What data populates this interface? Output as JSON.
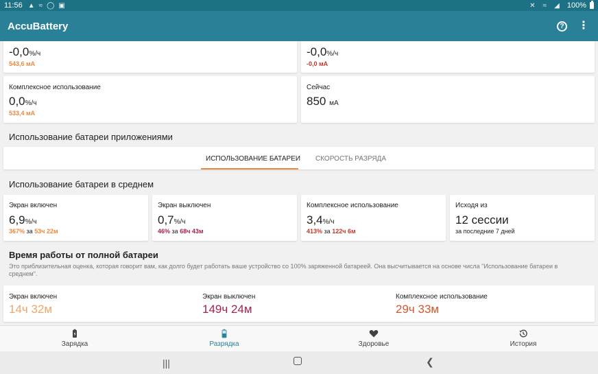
{
  "status_bar": {
    "time": "11:56",
    "battery": "100%",
    "icons": [
      "notification-icon",
      "cast-icon",
      "data-saver-icon",
      "gallery-icon",
      "mute-icon",
      "wifi-icon",
      "signal-icon",
      "battery-icon"
    ]
  },
  "app_bar": {
    "title": "AccuBattery",
    "help_icon": "help-icon",
    "more_icon": "more-vert-icon"
  },
  "top_cards": [
    {
      "label": "",
      "value": "-0,0",
      "unit": "%/ч",
      "sub": "543,6 мА",
      "sub_color": "#e8893f"
    },
    {
      "label": "",
      "value": "-0,0",
      "unit": "%/ч",
      "sub": "-0,0 мА",
      "sub_color": "#c0392b"
    },
    {
      "label": "Комплексное использование",
      "value": "0,0",
      "unit": "%/ч",
      "sub": "533,4 мА",
      "sub_color": "#e8893f"
    },
    {
      "label": "Сейчас",
      "value": "850",
      "unit": "мА",
      "sub": ""
    }
  ],
  "app_usage": {
    "title": "Использование батареи приложениями",
    "tabs": [
      {
        "label": "ИСПОЛЬЗОВАНИЕ БАТАРЕИ",
        "active": true
      },
      {
        "label": "СКОРОСТЬ РАЗРЯДА",
        "active": false
      }
    ]
  },
  "average": {
    "title": "Использование батареи в среднем",
    "cards": [
      {
        "label": "Экран включен",
        "value": "6,9",
        "unit": "%/ч",
        "pct": "367%",
        "over": "за",
        "duration": "53ч 22м",
        "color": "#e8893f"
      },
      {
        "label": "Экран выключен",
        "value": "0,7",
        "unit": "%/ч",
        "pct": "46%",
        "over": "за",
        "duration": "68ч 43м",
        "color": "#a5224f"
      },
      {
        "label": "Комплексное использование",
        "value": "3,4",
        "unit": "%/ч",
        "pct": "413%",
        "over": "за",
        "duration": "122ч 6м",
        "color": "#c0392b"
      },
      {
        "label": "Исходя из",
        "value": "12 сессии",
        "unit": "",
        "sub": "за последние 7 дней"
      }
    ]
  },
  "full_battery": {
    "title": "Время работы от полной батареи",
    "description": "Это приблизительная оценка, которая говорит вам, как долго будет работать ваше устройство со 100% заряженной батареей. Она высчитывается на основе числа \"Использование батареи в среднем\".",
    "items": [
      {
        "label": "Экран включен",
        "value": "14ч 32м",
        "color": "#f0a66a"
      },
      {
        "label": "Экран выключен",
        "value": "149ч 24м",
        "color": "#a5224f"
      },
      {
        "label": "Комплексное использование",
        "value": "29ч 33м",
        "color": "#d9552e"
      }
    ]
  },
  "bottom_nav": [
    {
      "label": "Зарядка",
      "icon": "battery-charging-icon",
      "active": false
    },
    {
      "label": "Разрядка",
      "icon": "battery-discharging-icon",
      "active": true
    },
    {
      "label": "Здоровье",
      "icon": "heart-icon",
      "active": false
    },
    {
      "label": "История",
      "icon": "history-icon",
      "active": false
    }
  ],
  "system_nav": {
    "recent_icon": "recents-icon",
    "home_icon": "home-icon",
    "back_icon": "back-icon"
  }
}
